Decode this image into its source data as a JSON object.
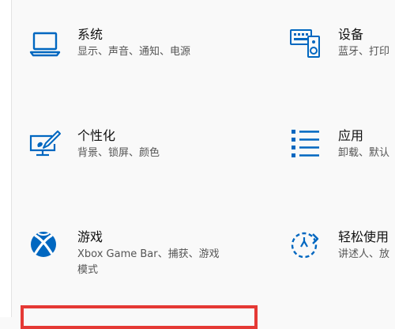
{
  "colors": {
    "accent": "#0067c0",
    "background": "#f9f9f9",
    "highlight_border": "#e53935"
  },
  "tiles": [
    {
      "id": "system",
      "icon": "laptop-icon",
      "title": "系统",
      "desc": "显示、声音、通知、电源"
    },
    {
      "id": "device",
      "icon": "keyboard-speaker-icon",
      "title": "设备",
      "desc": "蓝牙、打印"
    },
    {
      "id": "personalization",
      "icon": "paint-monitor-icon",
      "title": "个性化",
      "desc": "背景、锁屏、颜色"
    },
    {
      "id": "apps",
      "icon": "app-list-icon",
      "title": "应用",
      "desc": "卸载、默认"
    },
    {
      "id": "gaming",
      "icon": "xbox-icon",
      "title": "游戏",
      "desc": "Xbox Game Bar、捕获、游戏",
      "desc2": "模式"
    },
    {
      "id": "accessibility",
      "icon": "ease-of-access-icon",
      "title": "轻松使用",
      "desc": "讲述人、放"
    }
  ]
}
